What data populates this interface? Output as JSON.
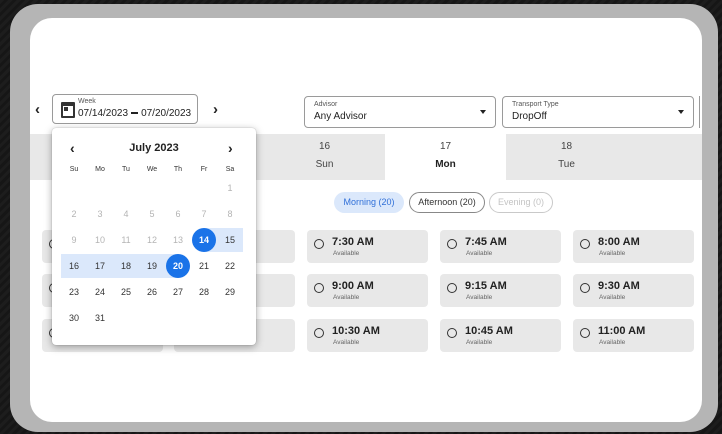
{
  "week_picker": {
    "label": "Week",
    "start": "07/14/2023",
    "end": "07/20/2023"
  },
  "advisor": {
    "label": "Advisor",
    "value": "Any Advisor"
  },
  "transport": {
    "label": "Transport Type",
    "value": "DropOff"
  },
  "days": [
    {
      "num": "16",
      "name": "Sun",
      "selected": false
    },
    {
      "num": "17",
      "name": "Mon",
      "selected": true
    },
    {
      "num": "18",
      "name": "Tue",
      "selected": false
    }
  ],
  "filters": {
    "morning": "Morning (20)",
    "afternoon": "Afternoon (20)",
    "evening": "Evening (0)"
  },
  "slots": [
    [
      {
        "time": "7:30 AM",
        "status": "Available"
      },
      {
        "time": "7:45 AM",
        "status": "Available"
      },
      {
        "time": "8:00 AM",
        "status": "Available"
      }
    ],
    [
      {
        "time": "9:00 AM",
        "status": "Available"
      },
      {
        "time": "9:15 AM",
        "status": "Available"
      },
      {
        "time": "9:30 AM",
        "status": "Available"
      }
    ],
    [
      {
        "time": "10:30 AM",
        "status": "Available"
      },
      {
        "time": "10:45 AM",
        "status": "Available"
      },
      {
        "time": "11:00 AM",
        "status": "Available"
      }
    ]
  ],
  "calendar": {
    "month": "July 2023",
    "weekdays": [
      "Su",
      "Mo",
      "Tu",
      "We",
      "Th",
      "Fr",
      "Sa"
    ],
    "weeks": [
      [
        "",
        "",
        "",
        "",
        "",
        "",
        "1"
      ],
      [
        "2",
        "3",
        "4",
        "5",
        "6",
        "7",
        "8"
      ],
      [
        "9",
        "10",
        "11",
        "12",
        "13",
        "14",
        "15"
      ],
      [
        "16",
        "17",
        "18",
        "19",
        "20",
        "21",
        "22"
      ],
      [
        "23",
        "24",
        "25",
        "26",
        "27",
        "28",
        "29"
      ],
      [
        "30",
        "31",
        "",
        "",
        "",
        "",
        ""
      ]
    ],
    "range_start": "14",
    "range_end": "20",
    "disabled_through": "13"
  },
  "colors": {
    "accent": "#1a73e8",
    "range": "#dbe8fb",
    "slot_bg": "#e8e8e8"
  }
}
